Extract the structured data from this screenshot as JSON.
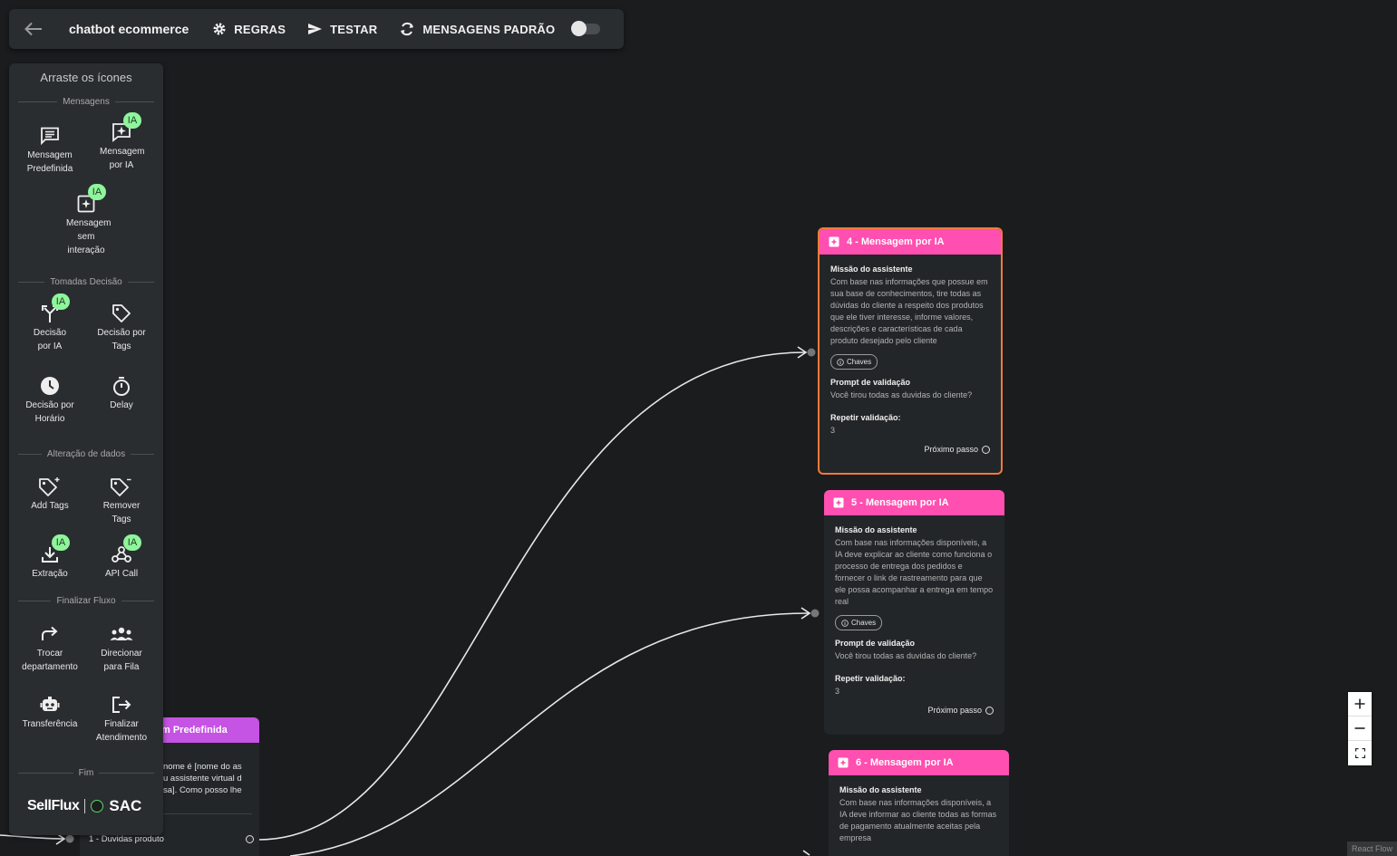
{
  "topbar": {
    "title": "chatbot ecommerce",
    "rules_label": "REGRAS",
    "test_label": "TESTAR",
    "default_msgs_label": "MENSAGENS PADRÃO"
  },
  "sidebar": {
    "header": "Arraste os ícones",
    "badge": "IA",
    "sections": {
      "messages": "Mensagens",
      "decisions": "Tomadas Decisão",
      "data": "Alteração de dados",
      "finish": "Finalizar Fluxo",
      "end": "Fim"
    },
    "tools": {
      "predefined": "Mensagem Predefinida",
      "ia_message": "Mensagem por IA",
      "no_interaction": "Mensagem sem interação",
      "decision_ia": "Decisão por IA",
      "decision_tags": "Decisão por Tags",
      "decision_time": "Decisão por Horário",
      "delay": "Delay",
      "add_tags": "Add Tags",
      "remove_tags": "Remover Tags",
      "extraction": "Extração",
      "api_call": "API Call",
      "change_dept": "Trocar departamento",
      "direct_queue": "Direcionar para Fila",
      "transfer": "Transferência",
      "finish_service": "Finalizar Atendimento"
    },
    "logo": {
      "brand": "SellFlux",
      "product": "SAC"
    }
  },
  "nodes": {
    "n4": {
      "title": "4 - Mensagem por IA",
      "mission_label": "Missão do assistente",
      "mission_text": "Com base nas informações que possue em sua base de conhecimentos, tire todas as dúvidas do cliente a respeito dos produtos que ele tiver interesse, informe valores, descrições e características de cada produto desejado pelo cliente",
      "keys_label": "Chaves",
      "prompt_label": "Prompt de validação",
      "prompt_text": "Você tirou todas as duvidas do cliente?",
      "repeat_label": "Repetir validação:",
      "repeat_value": "3",
      "next_label": "Próximo passo"
    },
    "n5": {
      "title": "5 - Mensagem por IA",
      "mission_label": "Missão do assistente",
      "mission_text": "Com base nas informações disponíveis, a IA deve explicar ao cliente como funciona o processo de entrega dos pedidos e fornecer o link de rastreamento para que ele possa acompanhar a entrega em tempo real",
      "keys_label": "Chaves",
      "prompt_label": "Prompt de validação",
      "prompt_text": "Você tirou todas as duvidas do cliente?",
      "repeat_label": "Repetir validação:",
      "repeat_value": "3",
      "next_label": "Próximo passo"
    },
    "n6": {
      "title": "6 - Mensagem por IA",
      "mission_label": "Missão do assistente",
      "mission_text": "Com base nas informações disponíveis, a IA deve informar ao cliente todas as formas de pagamento atualmente aceitas pela empresa"
    },
    "predef": {
      "title_fragment": "m Predefinida",
      "text_line1": "nome é [nome do as",
      "text_line2": "u assistente virtual d",
      "text_line3": "sa]. Como posso lhe",
      "option1": "1 - Duvidas produto"
    }
  },
  "attribution": "React Flow",
  "colors": {
    "background": "#1a1c1e",
    "ia_node_header": "#ff4fb0",
    "predef_node_header": "#c553e3",
    "selected_border": "#f07a3a",
    "ia_badge": "#8ef59b"
  }
}
